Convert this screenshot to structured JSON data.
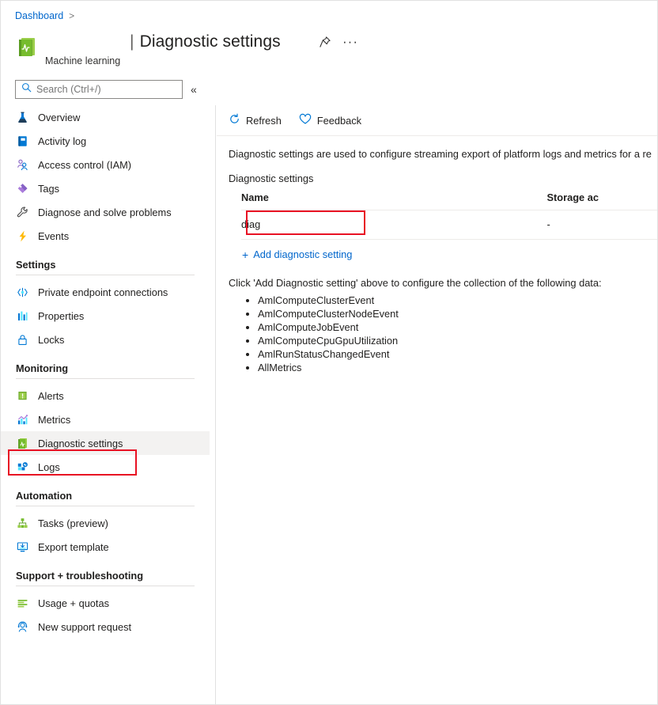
{
  "breadcrumb": {
    "root": "Dashboard",
    "separator": ">"
  },
  "resource": {
    "name": "Machine learning",
    "icon": "machine-learning-icon"
  },
  "header": {
    "title_bar": "|",
    "title": "Diagnostic settings",
    "pin_icon": "pin-icon",
    "more_icon": "ellipsis-icon"
  },
  "search": {
    "placeholder": "Search (Ctrl+/)",
    "value": "",
    "icon": "search-icon",
    "collapse_icon": "chevron-double-left-icon"
  },
  "sidebar": {
    "top_items": [
      {
        "label": "Overview",
        "icon": "flask-icon"
      },
      {
        "label": "Activity log",
        "icon": "activity-log-icon"
      },
      {
        "label": "Access control (IAM)",
        "icon": "people-icon"
      },
      {
        "label": "Tags",
        "icon": "tag-icon"
      },
      {
        "label": "Diagnose and solve problems",
        "icon": "wrench-icon"
      },
      {
        "label": "Events",
        "icon": "lightning-icon"
      }
    ],
    "groups": [
      {
        "title": "Settings",
        "items": [
          {
            "label": "Private endpoint connections",
            "icon": "private-endpoint-icon"
          },
          {
            "label": "Properties",
            "icon": "properties-icon"
          },
          {
            "label": "Locks",
            "icon": "lock-icon"
          }
        ]
      },
      {
        "title": "Monitoring",
        "items": [
          {
            "label": "Alerts",
            "icon": "alerts-icon"
          },
          {
            "label": "Metrics",
            "icon": "metrics-icon"
          },
          {
            "label": "Diagnostic settings",
            "icon": "diagnostic-settings-icon",
            "selected": true
          },
          {
            "label": "Logs",
            "icon": "logs-icon"
          }
        ]
      },
      {
        "title": "Automation",
        "items": [
          {
            "label": "Tasks (preview)",
            "icon": "tasks-icon"
          },
          {
            "label": "Export template",
            "icon": "export-template-icon"
          }
        ]
      },
      {
        "title": "Support + troubleshooting",
        "items": [
          {
            "label": "Usage + quotas",
            "icon": "usage-quotas-icon"
          },
          {
            "label": "New support request",
            "icon": "support-request-icon"
          }
        ]
      }
    ]
  },
  "commandbar": {
    "refresh": {
      "label": "Refresh",
      "icon": "refresh-icon"
    },
    "feedback": {
      "label": "Feedback",
      "icon": "heart-icon"
    }
  },
  "main": {
    "description": "Diagnostic settings are used to configure streaming export of platform logs and metrics for a re",
    "section_label": "Diagnostic settings",
    "table": {
      "columns": [
        "Name",
        "Storage ac"
      ],
      "rows": [
        {
          "name": "diag",
          "storage_account": "-"
        }
      ]
    },
    "add_link": {
      "label": "Add diagnostic setting",
      "plus": "+"
    },
    "hint": "Click 'Add Diagnostic setting' above to configure the collection of the following data:",
    "data_categories": [
      "AmlComputeClusterEvent",
      "AmlComputeClusterNodeEvent",
      "AmlComputeJobEvent",
      "AmlComputeCpuGpuUtilization",
      "AmlRunStatusChangedEvent",
      "AllMetrics"
    ]
  },
  "colors": {
    "link": "#0066cc",
    "highlight": "#e81123",
    "selected_row": "#f3f2f1"
  }
}
